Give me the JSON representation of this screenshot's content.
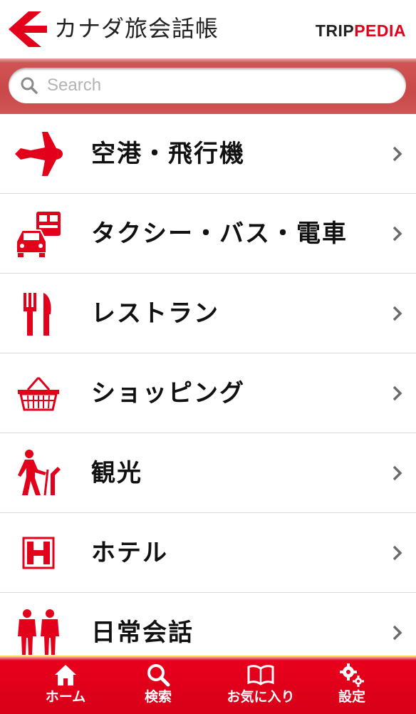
{
  "header": {
    "title": "カナダ旅会話帳",
    "brand_trip": "TRIP",
    "brand_pedia": "PEDIA"
  },
  "search": {
    "placeholder": "Search"
  },
  "categories": [
    {
      "label": "空港・飛行機",
      "icon": "airplane-icon"
    },
    {
      "label": "タクシー・バス・電車",
      "icon": "taxi-bus-train-icon"
    },
    {
      "label": "レストラン",
      "icon": "fork-knife-icon"
    },
    {
      "label": "ショッピング",
      "icon": "shopping-basket-icon"
    },
    {
      "label": "観光",
      "icon": "sightseeing-walker-icon"
    },
    {
      "label": "ホテル",
      "icon": "hotel-icon"
    },
    {
      "label": "日常会話",
      "icon": "people-icon"
    }
  ],
  "tabs": [
    {
      "label": "ホーム",
      "icon": "home-icon"
    },
    {
      "label": "検索",
      "icon": "search-icon"
    },
    {
      "label": "お気に入り",
      "icon": "book-icon"
    },
    {
      "label": "設定",
      "icon": "gear-icon"
    }
  ],
  "colors": {
    "accent": "#e3001b",
    "tabbar": "#e8001c",
    "tab_border": "#ffd34d"
  }
}
